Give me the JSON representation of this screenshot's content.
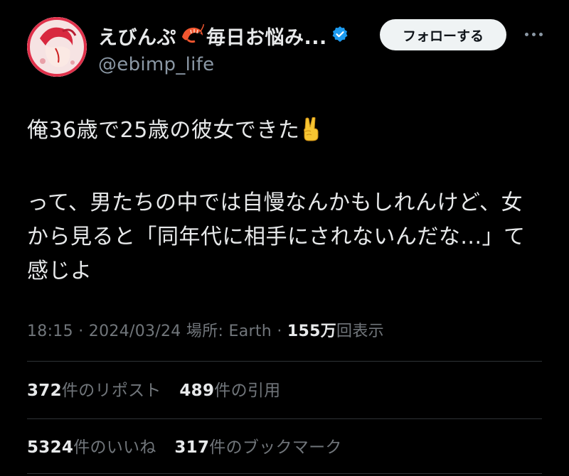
{
  "author": {
    "display_name": "えびんぷ",
    "display_name_suffix": "毎日お悩み...",
    "handle": "@ebimp_life",
    "verified": true,
    "follow_label": "フォローする"
  },
  "tweet": {
    "line1": "俺36歳で25歳の彼女できた",
    "line2": "って、男たちの中では自慢なんかもしれんけど、女",
    "line3": "から見ると「同年代に相手にされないんだな...」て",
    "line4": "感じよ"
  },
  "meta": {
    "time": "18:15",
    "separator": "·",
    "date": "2024/03/24",
    "location": "場所: Earth",
    "views_count": "155万",
    "views_label": "回表示"
  },
  "stats": {
    "reposts_count": "372",
    "reposts_label": "件のリポスト",
    "quotes_count": "489",
    "quotes_label": "件の引用",
    "likes_count": "5324",
    "likes_label": "件のいいね",
    "bookmarks_count": "317",
    "bookmarks_label": "件のブックマーク"
  },
  "colors": {
    "background": "#000000",
    "text": "#e7e9ea",
    "secondary": "#71767b",
    "verified": "#1d9bf0",
    "follow_bg": "#eff3f4"
  },
  "icons": [
    "shrimp-icon",
    "verified-icon",
    "more-icon",
    "victory-hand-icon"
  ]
}
